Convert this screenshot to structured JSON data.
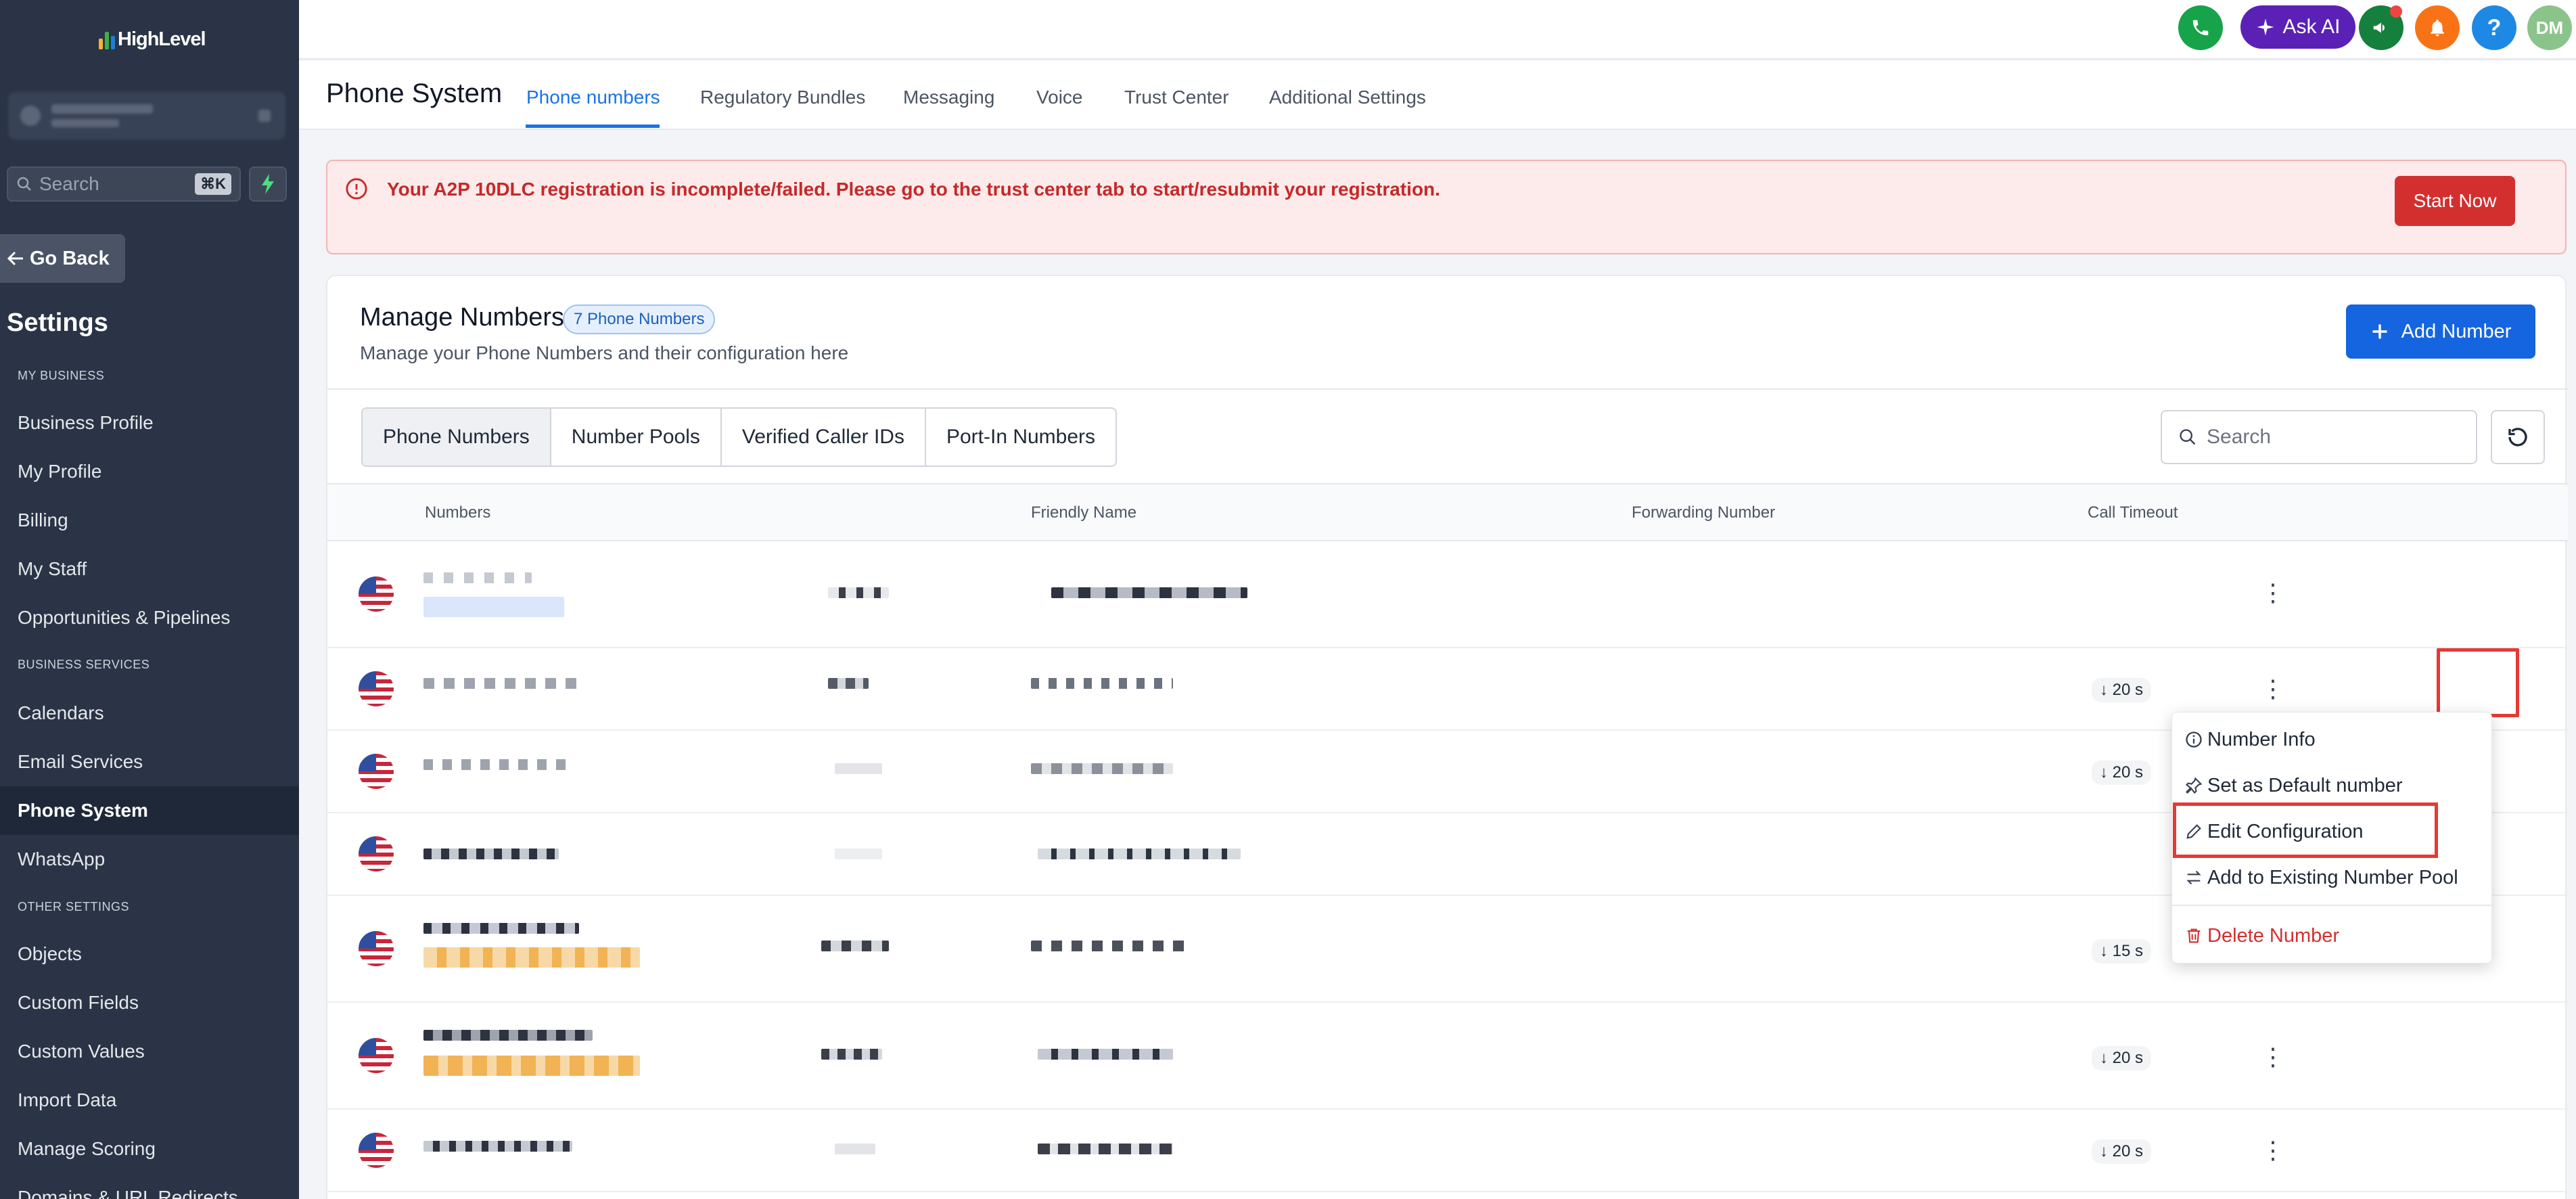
{
  "logo": {
    "text": "HighLevel"
  },
  "sidebar": {
    "search_placeholder": "Search",
    "search_shortcut": "⌘K",
    "go_back": "Go Back",
    "title": "Settings",
    "sections": [
      {
        "heading": "MY BUSINESS",
        "items": [
          "Business Profile",
          "My Profile",
          "Billing",
          "My Staff",
          "Opportunities & Pipelines"
        ]
      },
      {
        "heading": "BUSINESS SERVICES",
        "items": [
          "Calendars",
          "Email Services",
          "Phone System",
          "WhatsApp"
        ]
      },
      {
        "heading": "OTHER SETTINGS",
        "items": [
          "Objects",
          "Custom Fields",
          "Custom Values",
          "Import Data",
          "Manage Scoring",
          "Domains & URL Redirects"
        ]
      }
    ],
    "active_item": "Phone System"
  },
  "topbar": {
    "ask_ai": "Ask AI",
    "avatar": "DM",
    "help": "?"
  },
  "subnav": {
    "title": "Phone System",
    "tabs": [
      "Phone numbers",
      "Regulatory Bundles",
      "Messaging",
      "Voice",
      "Trust Center",
      "Additional Settings"
    ],
    "active_tab": "Phone numbers"
  },
  "alert": {
    "message": "Your A2P 10DLC registration is incomplete/failed. Please go to the trust center tab to start/resubmit your registration.",
    "button": "Start Now"
  },
  "manage": {
    "title": "Manage Numbers",
    "badge": "7 Phone Numbers",
    "subtitle": "Manage your Phone Numbers and their configuration here",
    "add_button": "Add Number",
    "segments": [
      "Phone Numbers",
      "Number Pools",
      "Verified Caller IDs",
      "Port-In Numbers"
    ],
    "active_segment": "Phone Numbers",
    "search_placeholder": "Search"
  },
  "table": {
    "columns": [
      "Numbers",
      "Friendly Name",
      "Forwarding Number",
      "Call Timeout"
    ],
    "rows": [
      {
        "timeout": ""
      },
      {
        "timeout": "20 s"
      },
      {
        "timeout": "20 s"
      },
      {
        "timeout": ""
      },
      {
        "timeout": "15 s"
      },
      {
        "timeout": "20 s"
      },
      {
        "timeout": "20 s"
      }
    ]
  },
  "context_menu": {
    "items": [
      "Number Info",
      "Set as Default number",
      "Edit Configuration",
      "Add to Existing Number Pool",
      "Delete Number"
    ]
  },
  "colors": {
    "accent": "#1a73e8",
    "sidebar": "#2a3446",
    "danger": "#d32f2f",
    "highlight": "#e53935"
  }
}
